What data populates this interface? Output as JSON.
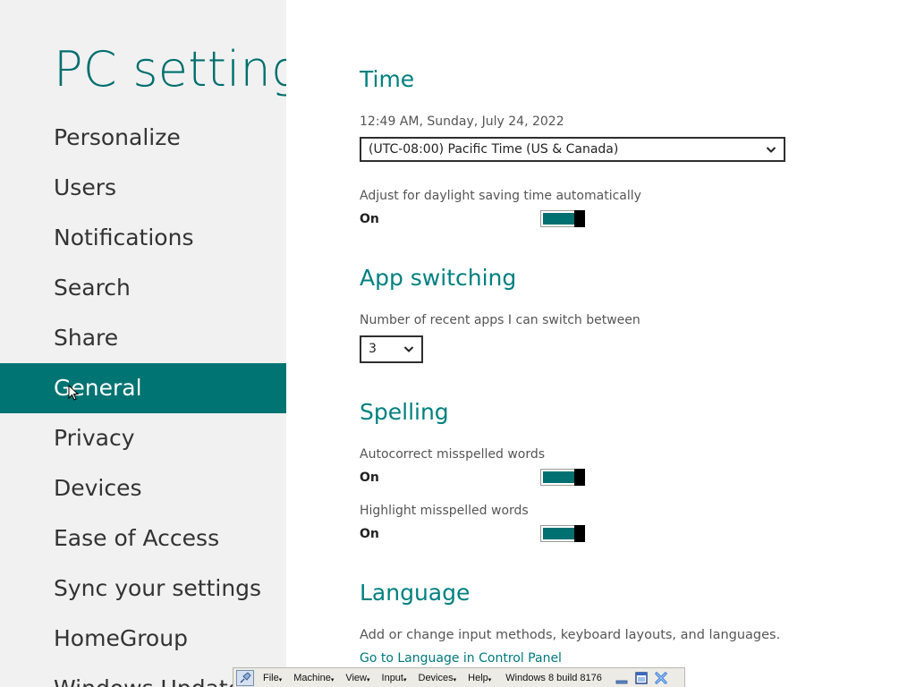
{
  "left": {
    "title": "PC settings",
    "nav": [
      {
        "label": "Personalize"
      },
      {
        "label": "Users"
      },
      {
        "label": "Notifications"
      },
      {
        "label": "Search"
      },
      {
        "label": "Share"
      },
      {
        "label": "General",
        "selected": true
      },
      {
        "label": "Privacy"
      },
      {
        "label": "Devices"
      },
      {
        "label": "Ease of Access"
      },
      {
        "label": "Sync your settings"
      },
      {
        "label": "HomeGroup"
      },
      {
        "label": "Windows Update"
      }
    ]
  },
  "time": {
    "heading": "Time",
    "datetime": "12:49 AM, Sunday, July 24, 2022",
    "timezone": "(UTC-08:00) Pacific Time (US & Canada)",
    "dst_label": "Adjust for daylight saving time automatically",
    "dst_state": "On"
  },
  "app_switching": {
    "heading": "App switching",
    "label": "Number of recent apps I can switch between",
    "value": "3"
  },
  "spelling": {
    "heading": "Spelling",
    "autocorrect_label": "Autocorrect misspelled words",
    "autocorrect_state": "On",
    "highlight_label": "Highlight misspelled words",
    "highlight_state": "On"
  },
  "language": {
    "heading": "Language",
    "description": "Add or change input methods, keyboard layouts, and languages.",
    "link": "Go to Language in Control Panel"
  },
  "vm_toolbar": {
    "menus": [
      "File",
      "Machine",
      "View",
      "Input",
      "Devices",
      "Help"
    ],
    "title": "Windows 8 build 8176"
  },
  "colors": {
    "accent": "#007373",
    "heading": "#008080",
    "left_pane_bg": "#f1f1f1"
  }
}
